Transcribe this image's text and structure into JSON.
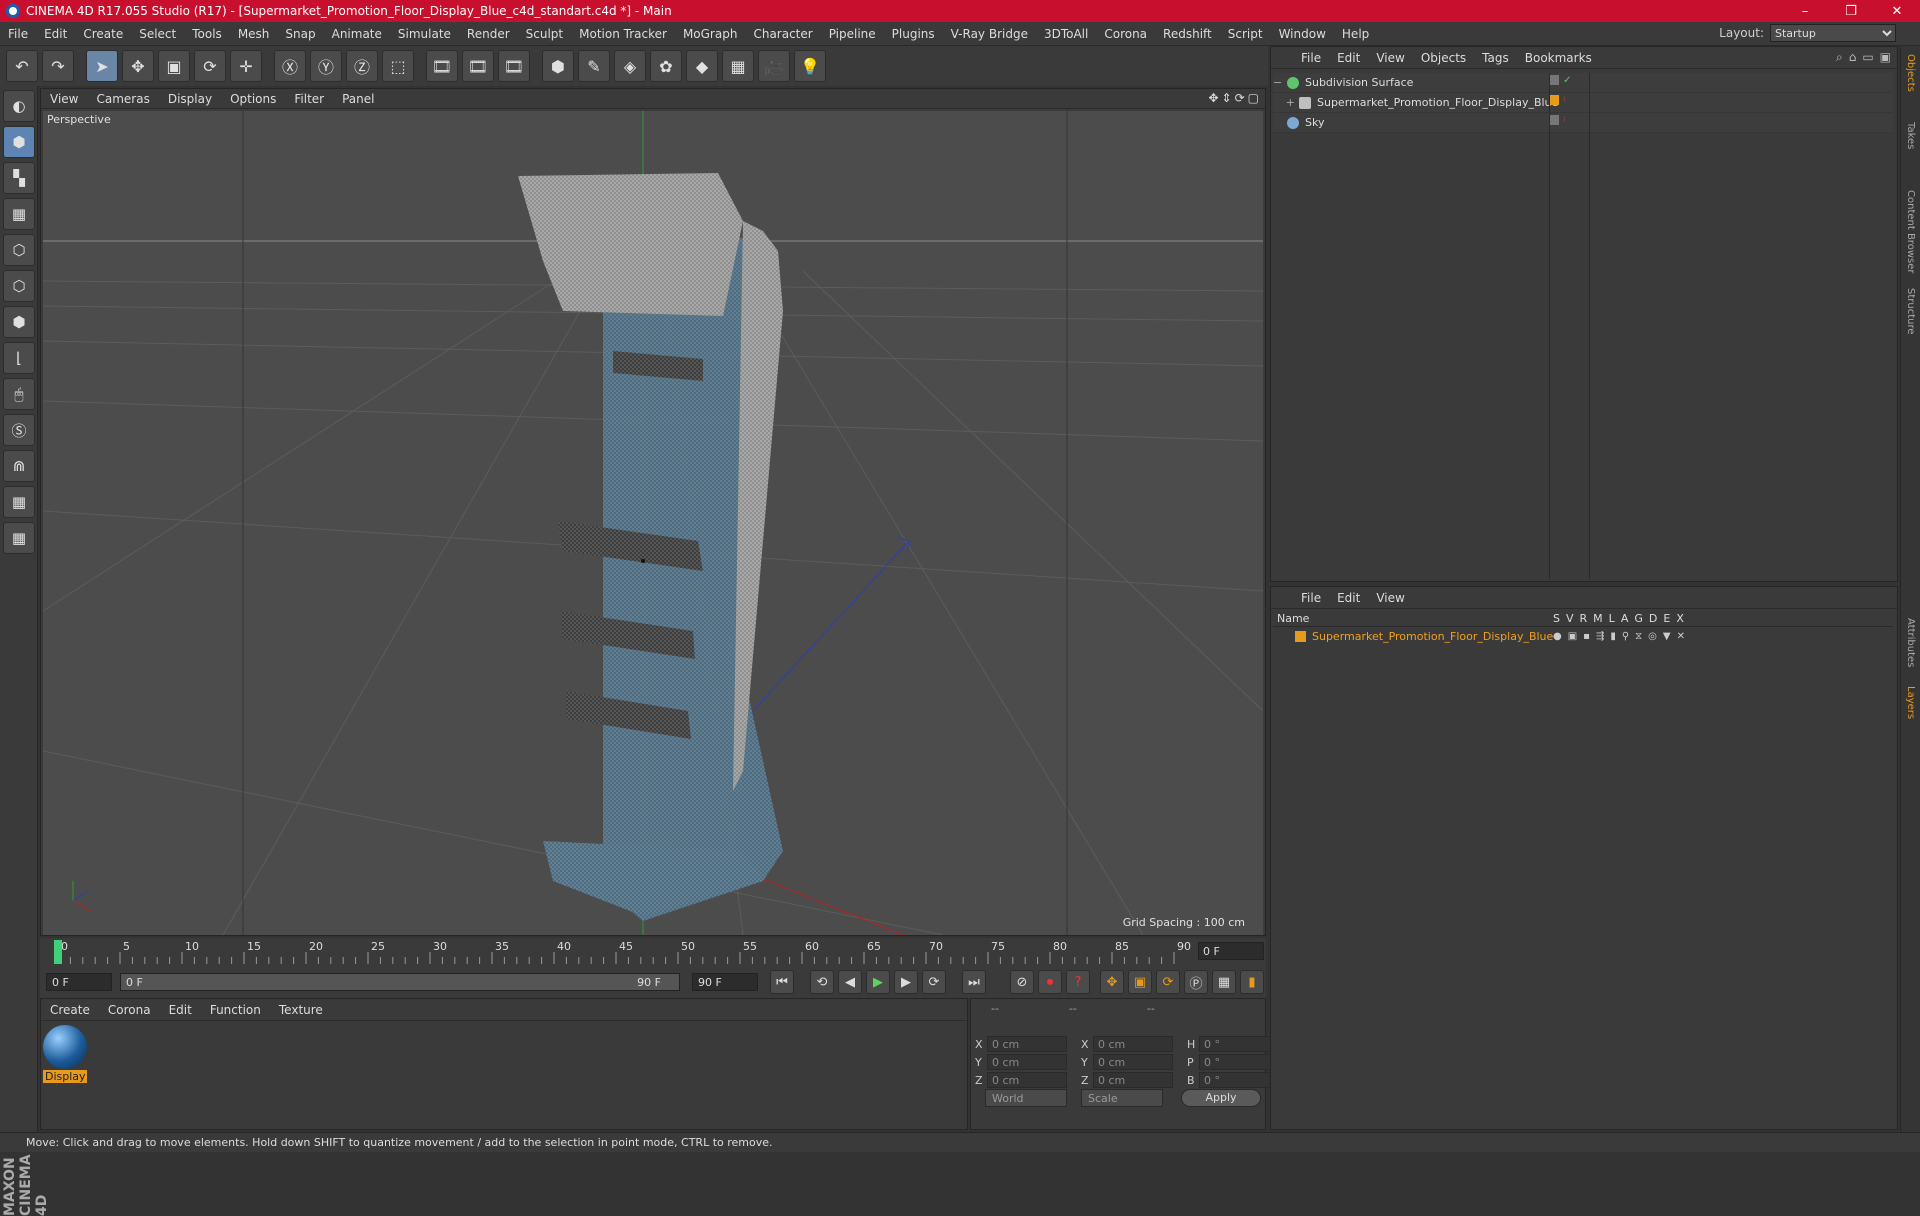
{
  "window": {
    "title": "CINEMA 4D R17.055 Studio (R17) - [Supermarket_Promotion_Floor_Display_Blue_c4d_standart.c4d *] - Main",
    "minimize": "–",
    "maximize": "❐",
    "close": "✕"
  },
  "menubar": {
    "items": [
      "File",
      "Edit",
      "Create",
      "Select",
      "Tools",
      "Mesh",
      "Snap",
      "Animate",
      "Simulate",
      "Render",
      "Sculpt",
      "Motion Tracker",
      "MoGraph",
      "Character",
      "Pipeline",
      "Plugins",
      "V-Ray Bridge",
      "3DToAll",
      "Corona",
      "Redshift",
      "Script",
      "Window",
      "Help"
    ],
    "layout_label": "Layout:",
    "layout_value": "Startup"
  },
  "viewport": {
    "menu": [
      "View",
      "Cameras",
      "Display",
      "Options",
      "Filter",
      "Panel"
    ],
    "camera_label": "Perspective",
    "grid_spacing": "Grid Spacing : 100 cm"
  },
  "timeline": {
    "ticks": [
      "0",
      "5",
      "10",
      "15",
      "20",
      "25",
      "30",
      "35",
      "40",
      "45",
      "50",
      "55",
      "60",
      "65",
      "70",
      "75",
      "80",
      "85",
      "90"
    ],
    "current_frame": "0 F",
    "start_frame": "0 F",
    "range_start": "0 F",
    "range_end": "90 F",
    "end_frame": "90 F"
  },
  "material_manager": {
    "menu": [
      "Create",
      "Corona",
      "Edit",
      "Function",
      "Texture"
    ],
    "material_name": "Display"
  },
  "coordinates": {
    "headers": [
      "--",
      "--",
      "--"
    ],
    "rows": [
      {
        "a": "X",
        "av": "0 cm",
        "b": "X",
        "bv": "0 cm",
        "c": "H",
        "cv": "0 °"
      },
      {
        "a": "Y",
        "av": "0 cm",
        "b": "Y",
        "bv": "0 cm",
        "c": "P",
        "cv": "0 °"
      },
      {
        "a": "Z",
        "av": "0 cm",
        "b": "Z",
        "bv": "0 cm",
        "c": "B",
        "cv": "0 °"
      }
    ],
    "space": "World",
    "mode": "Scale",
    "apply": "Apply"
  },
  "object_manager": {
    "menu": [
      "File",
      "Edit",
      "View",
      "Objects",
      "Tags",
      "Bookmarks"
    ],
    "objects": [
      {
        "name": "Subdivision Surface",
        "color": "#5ec46e"
      },
      {
        "name": "Supermarket_Promotion_Floor_Display_Blue",
        "color": "#bfbfbf"
      },
      {
        "name": "Sky",
        "color": "#7ea8d4"
      }
    ]
  },
  "layer_manager": {
    "menu": [
      "File",
      "Edit",
      "View"
    ],
    "name_header": "Name",
    "flags": [
      "S",
      "V",
      "R",
      "M",
      "L",
      "A",
      "G",
      "D",
      "E",
      "X"
    ],
    "layer_name": "Supermarket_Promotion_Floor_Display_Blue",
    "layer_color": "#e89a1d"
  },
  "right_tabs": [
    "Objects",
    "Takes",
    "Content Browser",
    "Structure",
    "Attributes",
    "Layers"
  ],
  "brand": "MAXON CINEMA 4D",
  "status": "Move: Click and drag to move elements. Hold down SHIFT to quantize movement / add to the selection in point mode, CTRL to remove."
}
